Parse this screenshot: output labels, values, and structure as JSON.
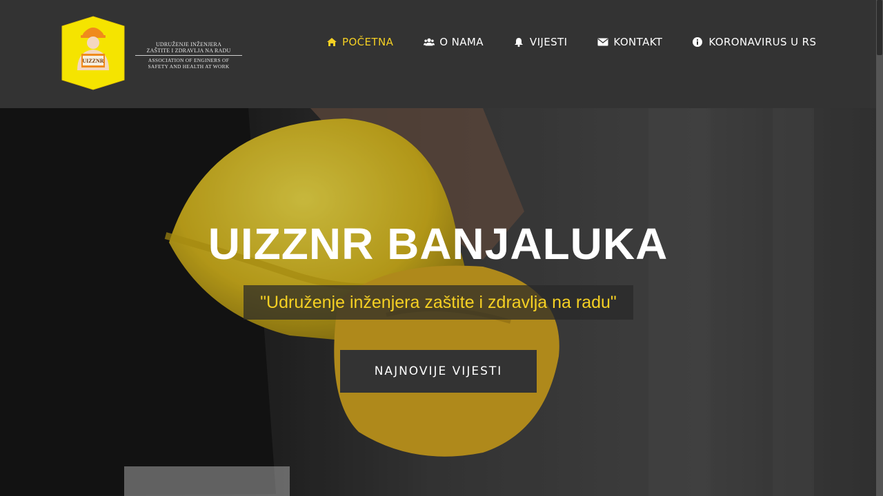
{
  "brand": {
    "badge_text": "UIZZNR",
    "line1": "UDRUŽENJE INŽENJERA",
    "line2": "ZAŠTITE I ZDRAVLJA NA RADU",
    "line3": "ASSOCIATION OF ENGINERS OF",
    "line4": "SAFETY AND HEALTH AT WORK"
  },
  "nav": {
    "items": [
      {
        "label": "POČETNA",
        "icon": "home-icon",
        "active": true
      },
      {
        "label": "O NAMA",
        "icon": "users-icon",
        "active": false
      },
      {
        "label": "VIJESTI",
        "icon": "bell-icon",
        "active": false
      },
      {
        "label": "KONTAKT",
        "icon": "envelope-icon",
        "active": false
      },
      {
        "label": "KORONAVIRUS U RS",
        "icon": "info-circle-icon",
        "active": false
      }
    ]
  },
  "hero": {
    "title": "UIZZNR BANJALUKA",
    "subtitle": "\"Udruženje inženjera zaštite i zdravlja na radu\"",
    "button_label": "NAJNOVIJE VIJESTI"
  },
  "colors": {
    "header_bg": "#333333",
    "accent": "#f5d023",
    "text": "#ffffff"
  }
}
